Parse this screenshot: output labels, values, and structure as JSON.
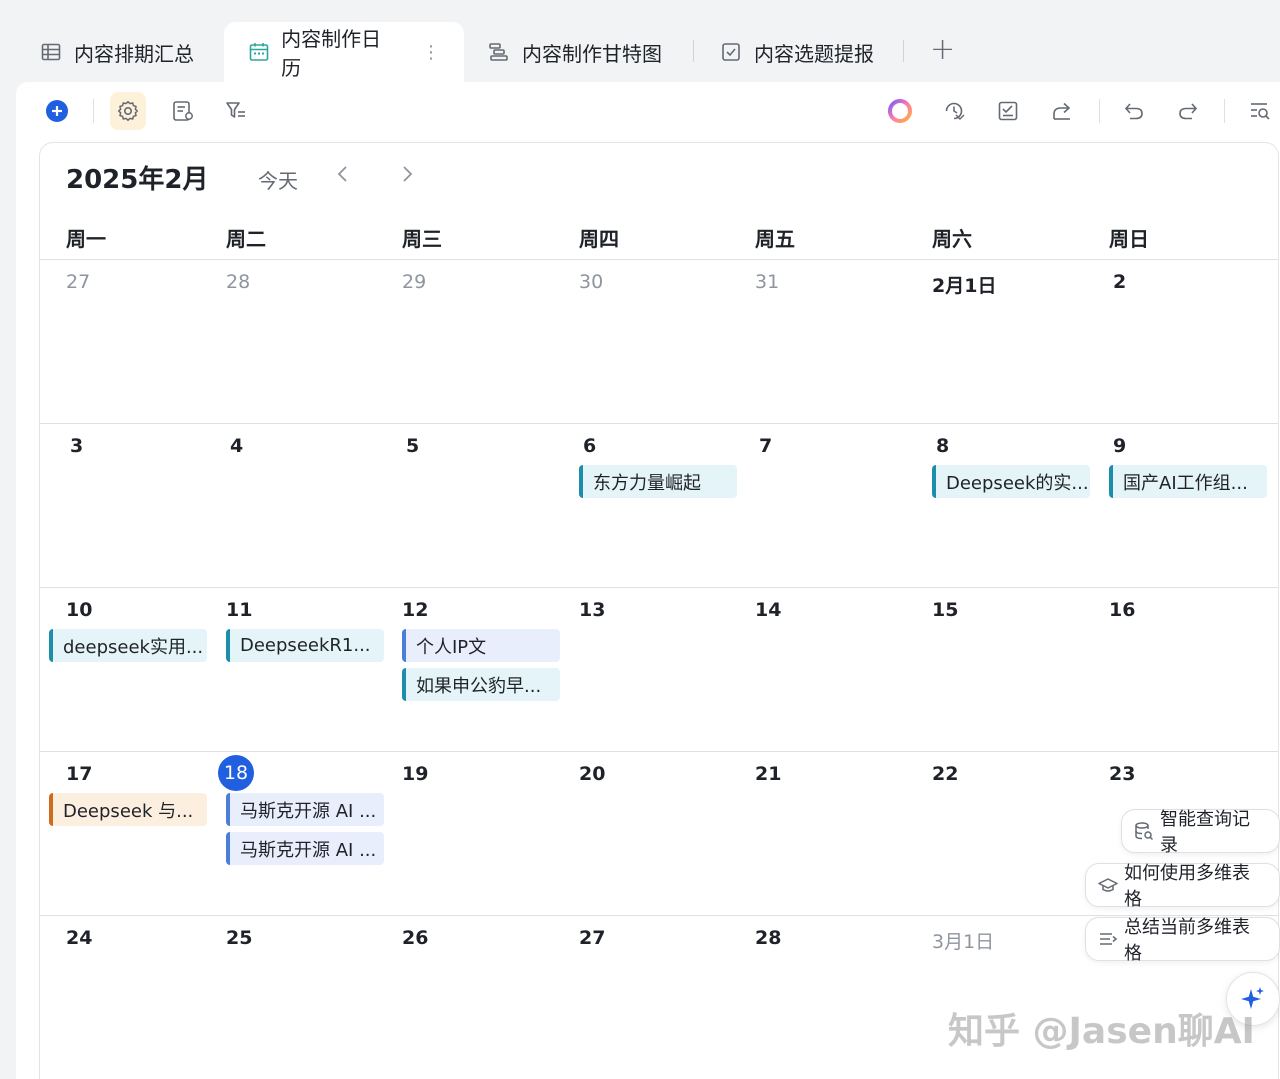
{
  "tabs": [
    {
      "label": "内容排期汇总",
      "icon": "table-grid-icon",
      "active": false
    },
    {
      "label": "内容制作日历",
      "icon": "calendar-icon",
      "active": true
    },
    {
      "label": "内容制作甘特图",
      "icon": "gantt-icon",
      "active": false
    },
    {
      "label": "内容选题提报",
      "icon": "form-checkbox-icon",
      "active": false
    }
  ],
  "add_tab_label": "+",
  "kebab": "⋮",
  "toolbar": {
    "left": [
      "add-record-icon",
      "settings-gear-icon",
      "field-config-icon",
      "filter-icon"
    ],
    "right": [
      "ai-orb-icon",
      "history-icon",
      "check-list-icon",
      "share-icon",
      "undo-icon",
      "redo-icon",
      "search-list-icon"
    ]
  },
  "calendar": {
    "title": "2025年2月",
    "today_label": "今天",
    "prev": "‹",
    "next": "›",
    "weekdays": [
      "周一",
      "周二",
      "周三",
      "周四",
      "周五",
      "周六",
      "周日"
    ],
    "weeks": [
      {
        "days": [
          {
            "label": "27",
            "muted": true
          },
          {
            "label": "28",
            "muted": true
          },
          {
            "label": "29",
            "muted": true
          },
          {
            "label": "30",
            "muted": true
          },
          {
            "label": "31",
            "muted": true
          },
          {
            "label": "2月1日",
            "muted": false
          },
          {
            "label": "2",
            "muted": false
          }
        ]
      },
      {
        "days": [
          {
            "label": "3"
          },
          {
            "label": "4"
          },
          {
            "label": "5"
          },
          {
            "label": "6"
          },
          {
            "label": "7"
          },
          {
            "label": "8"
          },
          {
            "label": "9"
          }
        ]
      },
      {
        "days": [
          {
            "label": "10"
          },
          {
            "label": "11"
          },
          {
            "label": "12"
          },
          {
            "label": "13"
          },
          {
            "label": "14"
          },
          {
            "label": "15"
          },
          {
            "label": "16"
          }
        ]
      },
      {
        "days": [
          {
            "label": "17"
          },
          {
            "label": "18",
            "today": true
          },
          {
            "label": "19"
          },
          {
            "label": "20"
          },
          {
            "label": "21"
          },
          {
            "label": "22"
          },
          {
            "label": "23"
          }
        ]
      },
      {
        "days": [
          {
            "label": "24"
          },
          {
            "label": "25"
          },
          {
            "label": "26"
          },
          {
            "label": "27"
          },
          {
            "label": "28"
          },
          {
            "label": "3月1日",
            "muted": true
          },
          {
            "label": ""
          }
        ]
      }
    ],
    "events": [
      {
        "text": "东方力量崛起",
        "color": "teal"
      },
      {
        "text": "Deepseek的实...",
        "color": "teal"
      },
      {
        "text": "国产AI工作组...",
        "color": "teal"
      },
      {
        "text": "deepseek实用...",
        "color": "teal"
      },
      {
        "text": "DeepseekR1...",
        "color": "teal"
      },
      {
        "text": "个人IP文",
        "color": "blue"
      },
      {
        "text": "如果申公豹早...",
        "color": "teal"
      },
      {
        "text": "Deepseek 与...",
        "color": "orange"
      },
      {
        "text": "马斯克开源 AI ...",
        "color": "blue"
      },
      {
        "text": "马斯克开源 AI ...",
        "color": "blue"
      }
    ]
  },
  "ai_panel": {
    "items": [
      {
        "label": "智能查询记录",
        "icon": "db-search-icon"
      },
      {
        "label": "如何使用多维表格",
        "icon": "graduation-cap-icon"
      },
      {
        "label": "总结当前多维表格",
        "icon": "summary-lines-icon"
      }
    ],
    "fab_icon": "sparkle-icon"
  },
  "watermark": "知乎 @Jasen聊AI"
}
